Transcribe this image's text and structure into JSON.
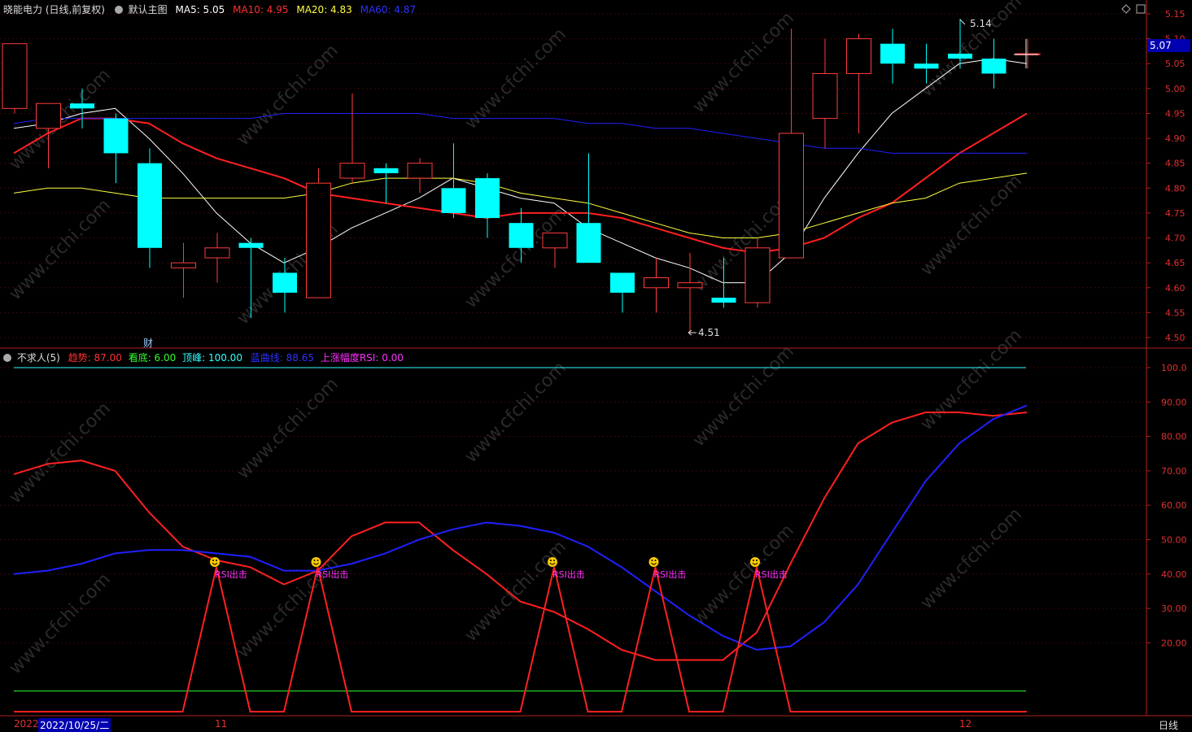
{
  "header": {
    "stock_title": "晓能电力 (日线,前复权)",
    "template_name": "默认主图",
    "ma5": "MA5: 5.05",
    "ma10": "MA10: 4.95",
    "ma20": "MA20: 4.83",
    "ma60": "MA60: 4.87"
  },
  "indicator_header": {
    "name": "不求人(5)",
    "trend": "趋势: 87.00",
    "bottom": "看底: 6.00",
    "top": "顶峰: 100.00",
    "blue_line": "蓝曲线: 88.65",
    "rsi": "上涨幅度RSI: 0.00"
  },
  "current_price_tag": "5.07",
  "bottom_axis": {
    "year_label": "2022",
    "cursor_date": "2022/10/25/二",
    "nov_label": "11",
    "dec_label": "12",
    "period_label": "日线"
  },
  "fin_marker": "财",
  "watermark": "www.cfchi.com",
  "signal_label": "RSI出击",
  "colors": {
    "up": "#ff3c3c",
    "down": "#00ffff",
    "ma5": "#ffffff",
    "ma10": "#ff2020",
    "ma20": "#ffff40",
    "ma60": "#2020ff",
    "axis": "#e03030"
  },
  "chart_data": [
    {
      "type": "candlestick",
      "title": "晓能电力 (日线,前复权)",
      "y_ticks": [
        "5.15",
        "5.10",
        "5.05",
        "5.00",
        "4.95",
        "4.90",
        "4.85",
        "4.80",
        "4.75",
        "4.70",
        "4.65",
        "4.60",
        "4.55",
        "4.50"
      ],
      "ylim": [
        4.48,
        5.17
      ],
      "annotations": {
        "high": "5.14",
        "low": "4.51"
      },
      "ohlc": [
        {
          "o": 4.96,
          "h": 5.09,
          "l": 4.95,
          "c": 5.09
        },
        {
          "o": 4.92,
          "h": 4.97,
          "l": 4.84,
          "c": 4.97
        },
        {
          "o": 4.97,
          "h": 5.0,
          "l": 4.92,
          "c": 4.96
        },
        {
          "o": 4.94,
          "h": 4.95,
          "l": 4.81,
          "c": 4.87
        },
        {
          "o": 4.85,
          "h": 4.88,
          "l": 4.64,
          "c": 4.68
        },
        {
          "o": 4.64,
          "h": 4.69,
          "l": 4.58,
          "c": 4.65
        },
        {
          "o": 4.66,
          "h": 4.71,
          "l": 4.61,
          "c": 4.68
        },
        {
          "o": 4.69,
          "h": 4.7,
          "l": 4.54,
          "c": 4.68
        },
        {
          "o": 4.63,
          "h": 4.66,
          "l": 4.55,
          "c": 4.59
        },
        {
          "o": 4.58,
          "h": 4.84,
          "l": 4.58,
          "c": 4.81
        },
        {
          "o": 4.82,
          "h": 4.99,
          "l": 4.81,
          "c": 4.85
        },
        {
          "o": 4.84,
          "h": 4.85,
          "l": 4.77,
          "c": 4.83
        },
        {
          "o": 4.82,
          "h": 4.86,
          "l": 4.79,
          "c": 4.85
        },
        {
          "o": 4.8,
          "h": 4.89,
          "l": 4.74,
          "c": 4.75
        },
        {
          "o": 4.82,
          "h": 4.83,
          "l": 4.7,
          "c": 4.74
        },
        {
          "o": 4.73,
          "h": 4.76,
          "l": 4.65,
          "c": 4.68
        },
        {
          "o": 4.68,
          "h": 4.71,
          "l": 4.64,
          "c": 4.71
        },
        {
          "o": 4.73,
          "h": 4.87,
          "l": 4.65,
          "c": 4.65
        },
        {
          "o": 4.63,
          "h": 4.63,
          "l": 4.55,
          "c": 4.59
        },
        {
          "o": 4.6,
          "h": 4.66,
          "l": 4.55,
          "c": 4.62
        },
        {
          "o": 4.6,
          "h": 4.67,
          "l": 4.51,
          "c": 4.61
        },
        {
          "o": 4.58,
          "h": 4.66,
          "l": 4.56,
          "c": 4.57
        },
        {
          "o": 4.57,
          "h": 4.7,
          "l": 4.56,
          "c": 4.68
        },
        {
          "o": 4.66,
          "h": 5.12,
          "l": 4.66,
          "c": 4.91
        },
        {
          "o": 4.94,
          "h": 5.1,
          "l": 4.88,
          "c": 5.03
        },
        {
          "o": 5.03,
          "h": 5.11,
          "l": 4.91,
          "c": 5.1
        },
        {
          "o": 5.09,
          "h": 5.12,
          "l": 5.01,
          "c": 5.05
        },
        {
          "o": 5.05,
          "h": 5.09,
          "l": 5.01,
          "c": 5.04
        },
        {
          "o": 5.07,
          "h": 5.14,
          "l": 5.04,
          "c": 5.06
        },
        {
          "o": 5.06,
          "h": 5.1,
          "l": 5.0,
          "c": 5.03
        },
        {
          "o": 5.07,
          "h": 5.1,
          "l": 5.04,
          "c": 5.07
        }
      ],
      "series": [
        {
          "name": "MA5",
          "values": [
            4.92,
            4.93,
            4.95,
            4.96,
            4.9,
            4.83,
            4.75,
            4.69,
            4.65,
            4.68,
            4.72,
            4.75,
            4.78,
            4.82,
            4.8,
            4.78,
            4.77,
            4.72,
            4.69,
            4.66,
            4.64,
            4.61,
            4.61,
            4.67,
            4.78,
            4.87,
            4.95,
            5.0,
            5.05,
            5.06,
            5.05
          ]
        },
        {
          "name": "MA10",
          "values": [
            4.87,
            4.91,
            4.94,
            4.94,
            4.93,
            4.89,
            4.86,
            4.84,
            4.82,
            4.79,
            4.78,
            4.77,
            4.76,
            4.75,
            4.74,
            4.75,
            4.75,
            4.75,
            4.74,
            4.72,
            4.7,
            4.68,
            4.67,
            4.68,
            4.7,
            4.74,
            4.77,
            4.82,
            4.87,
            4.91,
            4.95
          ]
        },
        {
          "name": "MA20",
          "values": [
            4.79,
            4.8,
            4.8,
            4.79,
            4.78,
            4.78,
            4.78,
            4.78,
            4.78,
            4.79,
            4.81,
            4.82,
            4.82,
            4.82,
            4.81,
            4.79,
            4.78,
            4.77,
            4.75,
            4.73,
            4.71,
            4.7,
            4.7,
            4.71,
            4.73,
            4.75,
            4.77,
            4.78,
            4.81,
            4.82,
            4.83
          ]
        },
        {
          "name": "MA60",
          "values": [
            4.93,
            4.94,
            4.94,
            4.94,
            4.94,
            4.94,
            4.94,
            4.94,
            4.95,
            4.95,
            4.95,
            4.95,
            4.95,
            4.94,
            4.94,
            4.94,
            4.94,
            4.93,
            4.93,
            4.92,
            4.92,
            4.91,
            4.9,
            4.89,
            4.88,
            4.88,
            4.87,
            4.87,
            4.87,
            4.87,
            4.87
          ]
        }
      ]
    },
    {
      "type": "line",
      "title": "不求人(5)",
      "y_ticks": [
        "100.0",
        "90.00",
        "80.00",
        "70.00",
        "60.00",
        "50.00",
        "40.00",
        "30.00",
        "20.00"
      ],
      "ylim": [
        0,
        105
      ],
      "top_line": 100,
      "bottom_line": 6,
      "series": [
        {
          "name": "趋势",
          "values": [
            69,
            72,
            73,
            70,
            58,
            48,
            44,
            42,
            37,
            41,
            51,
            55,
            55,
            47,
            40,
            32,
            29,
            24,
            18,
            15,
            15,
            15,
            23,
            43,
            62,
            78,
            84,
            87,
            87,
            86,
            87
          ]
        },
        {
          "name": "蓝曲线",
          "values": [
            40,
            41,
            43,
            46,
            47,
            47,
            46,
            45,
            41,
            41,
            43,
            46,
            50,
            53,
            55,
            54,
            52,
            48,
            42,
            35,
            28,
            22,
            18,
            19,
            26,
            37,
            52,
            67,
            78,
            85,
            89
          ]
        },
        {
          "name": "上涨幅度RSI",
          "values": [
            0,
            0,
            0,
            0,
            0,
            0,
            42,
            0,
            0,
            42,
            0,
            0,
            0,
            0,
            0,
            0,
            42,
            0,
            0,
            42,
            0,
            0,
            42,
            0,
            0,
            0,
            0,
            0,
            0,
            0,
            0
          ]
        }
      ],
      "signals_at": [
        6,
        9,
        16,
        19,
        22
      ]
    }
  ]
}
